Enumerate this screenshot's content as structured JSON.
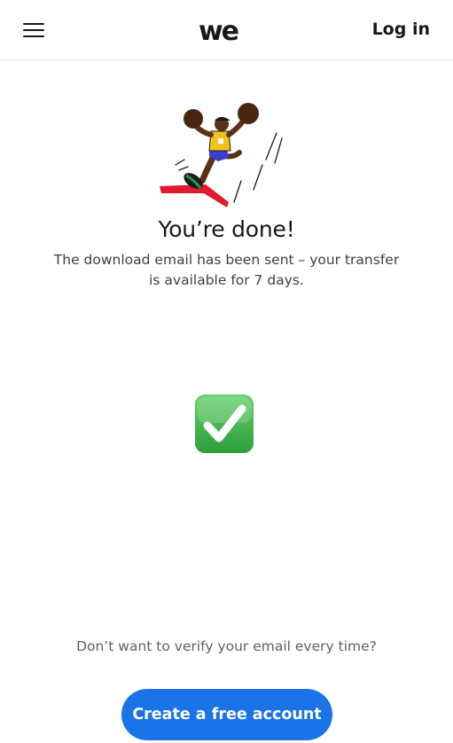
{
  "header": {
    "menu_icon": "hamburger-menu-icon",
    "logo_text": "we",
    "login_label": "Log in"
  },
  "illustration": {
    "icon": "celebrating-runner-illustration"
  },
  "main": {
    "title": "You’re done!",
    "subtitle": "The download email has been sent – your transfer is available for 7 days.",
    "status_icon": "green-check-mark-icon"
  },
  "footer": {
    "prompt": "Don’t want to verify your email every time?",
    "cta_label": "Create a free account"
  },
  "colors": {
    "accent": "#1a73e8",
    "check_green": "#3fb34f",
    "text": "#17181a"
  }
}
